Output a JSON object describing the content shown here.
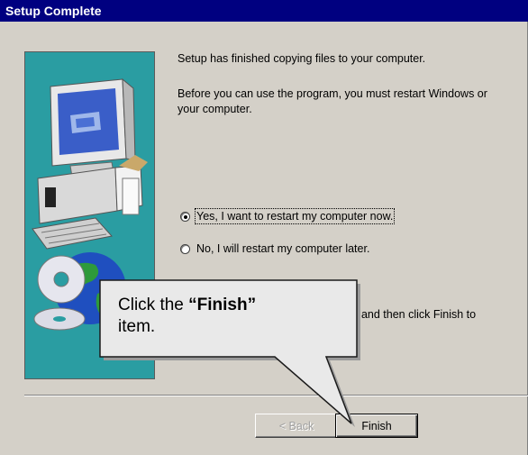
{
  "window": {
    "title": "Setup Complete"
  },
  "body": {
    "line1": "Setup has finished copying files to your computer.",
    "line2": "Before you can use the program, you must restart Windows or your computer."
  },
  "options": [
    {
      "label": "Yes, I want to restart my computer now.",
      "checked": true
    },
    {
      "label": "No, I will restart my computer later.",
      "checked": false
    }
  ],
  "partial_text": ", and then click Finish to",
  "buttons": {
    "back": "< Back",
    "finish": "Finish"
  },
  "callout": {
    "prefix": "Click the ",
    "emphasis": "“Finish”",
    "suffix": "item."
  },
  "colors": {
    "titlebar": "#000080",
    "dialog": "#d4d0c8",
    "art_panel": "#2a9da2"
  },
  "illustration_icons": [
    "computer-monitor-icon",
    "computer-tower-icon",
    "keyboard-icon",
    "cd-disc-icon",
    "globe-icon"
  ]
}
